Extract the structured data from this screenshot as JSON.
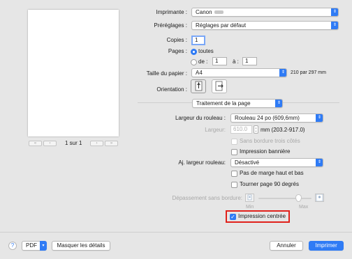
{
  "printer": {
    "label": "Imprimante :",
    "value": "Canon"
  },
  "presets": {
    "label": "Préréglages :",
    "value": "Réglages par défaut"
  },
  "copies": {
    "label": "Copies :",
    "value": "1"
  },
  "pages": {
    "label": "Pages :",
    "all": "toutes",
    "from": "de :",
    "from_value": "1",
    "to": "à :",
    "to_value": "1"
  },
  "paper_size": {
    "label": "Taille du papier :",
    "value": "A4",
    "dims": "210 par 297 mm"
  },
  "orientation": {
    "label": "Orientation :"
  },
  "preview_nav": {
    "first": "«",
    "prev": "‹",
    "page": "1 sur 1",
    "next": "›",
    "last": "»"
  },
  "section": {
    "value": "Traitement de la page"
  },
  "roll_width": {
    "label": "Largeur du rouleau :",
    "value": "Rouleau 24 po (609,6mm)"
  },
  "width": {
    "label": "Largeur:",
    "value": "610.0",
    "unit": "mm (203.2-917.0)"
  },
  "options": {
    "borderless_3": "Sans bordure trois côtés",
    "banner": "Impression bannière",
    "no_margin": "Pas de marge haut et bas",
    "rotate": "Tourner page 90 degrés",
    "centered": "Impression centrée"
  },
  "adjust_roll": {
    "label": "Aj. largeur rouleau:",
    "value": "Désactivé"
  },
  "overflow": {
    "label": "Dépassement sans bordure:",
    "min": "Min",
    "max": "Max",
    "level": 0.75
  },
  "footer": {
    "help": "?",
    "pdf": "PDF",
    "hide_details": "Masquer les détails",
    "cancel": "Annuler",
    "print": "Imprimer"
  },
  "colors": {
    "accent": "#2f7bf5",
    "highlight": "#e0211b"
  }
}
